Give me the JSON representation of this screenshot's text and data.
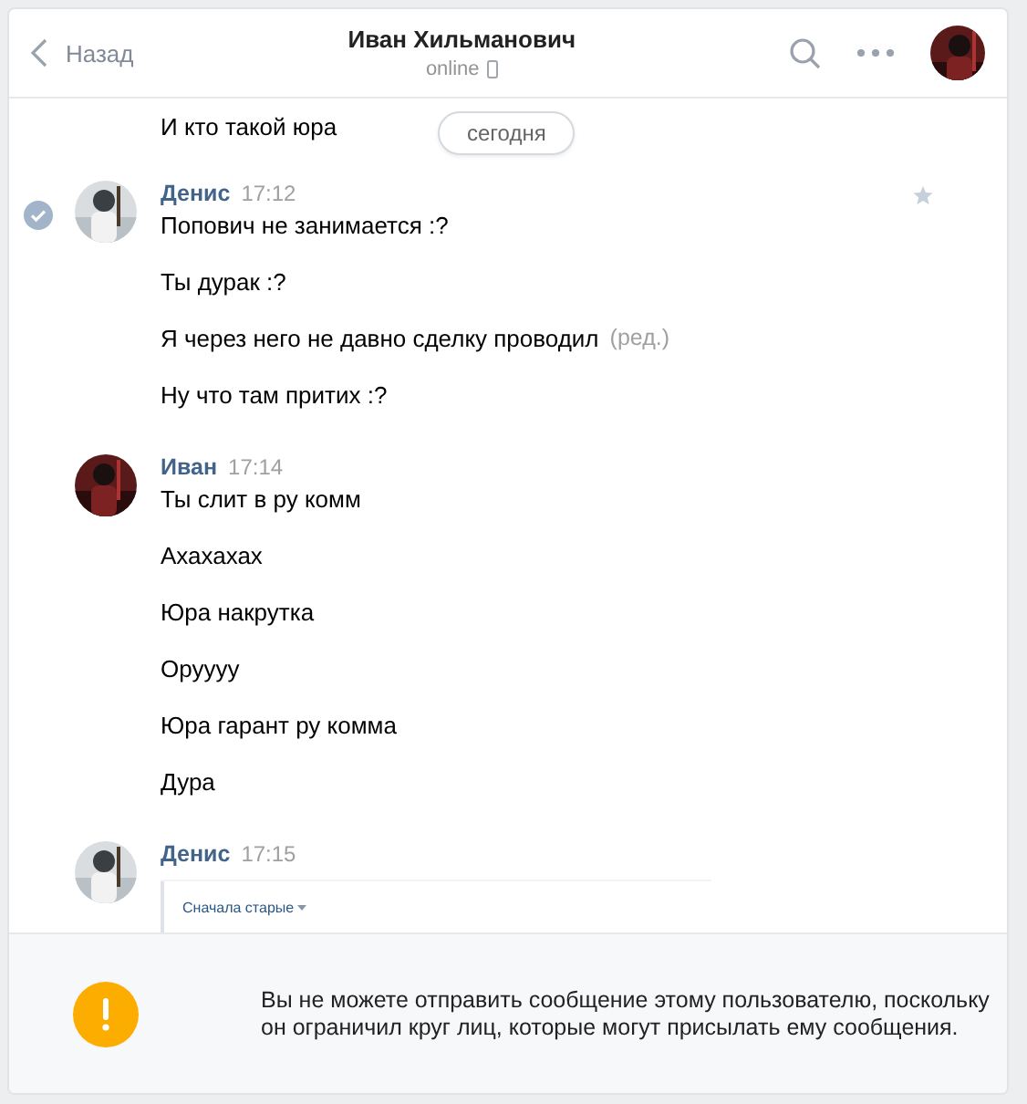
{
  "header": {
    "back": "Назад",
    "title": "Иван Хильманович",
    "status": "online"
  },
  "date_badge": "сегодня",
  "previous_message": "И кто такой юра",
  "groups": [
    {
      "author": "Денис",
      "time": "17:12",
      "selected": true,
      "messages": [
        {
          "text": "Попович не занимается :?"
        },
        {
          "text": "Ты дурак :?"
        },
        {
          "text": "Я через него не давно сделку проводил",
          "edited": "(ред.)"
        },
        {
          "text": "Ну что там притих :?"
        }
      ]
    },
    {
      "author": "Иван",
      "time": "17:14",
      "selected": false,
      "messages": [
        {
          "text": "Ты слит в ру комм"
        },
        {
          "text": "Ахахахах"
        },
        {
          "text": "Юра накрутка"
        },
        {
          "text": "Оруууу"
        },
        {
          "text": "Юра гарант ру комма"
        },
        {
          "text": "Дура"
        }
      ]
    },
    {
      "author": "Денис",
      "time": "17:15",
      "selected": false,
      "attachment": {
        "sort": "Сначала старые"
      }
    }
  ],
  "notice": "Вы не можете отправить сообщение этому пользователю, поскольку он ограничил круг лиц, которые могут присылать ему сообщения."
}
